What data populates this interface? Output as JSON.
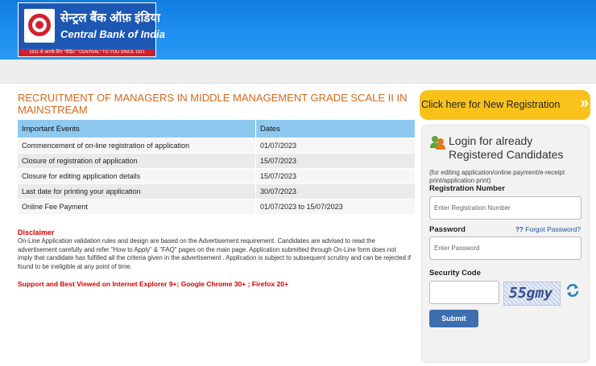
{
  "header": {
    "logo_hindi": "सेन्ट्रल बैंक ऑफ़ इंडिया",
    "logo_english": "Central Bank of India",
    "logo_tagline": "1911 से आपके लिए \"केंद्रित\"   \"CENTRAL\" TO YOU SINCE 1911"
  },
  "page_title": "RECRUITMENT OF MANAGERS IN MIDDLE MANAGEMENT GRADE SCALE II IN MAINSTREAM",
  "events_table": {
    "headers": [
      "Important Events",
      "Dates"
    ],
    "rows": [
      {
        "event": "Commencement of on-line registration of application",
        "date": "01/07/2023"
      },
      {
        "event": "Closure of registration of application",
        "date": "15/07/2023"
      },
      {
        "event": "Closure for editing application details",
        "date": "15/07/2023"
      },
      {
        "event": "Last date for printing your application",
        "date": "30/07/2023"
      },
      {
        "event": "Online Fee Payment",
        "date": "01/07/2023 to 15/07/2023"
      }
    ]
  },
  "disclaimer": {
    "heading": "Disclaimer",
    "text": "On-Line Application validation rules and design are based on the Advertisement requirement. Candidates are advised to read the advertisement carefully and refer \"How to Apply\" & \"FAQ\" pages on the main page. Application submitted through On-Line form does not imply that candidate has fulfilled all the criteria given in the advertisement . Application is subject to subsequent scrutiny and can be rejected if found to be ineligible at any point of time."
  },
  "support_text": "Support and Best Viewed on Internet Explorer 9+; Google Chrome 30+ ; Firefox 20+",
  "new_registration": {
    "label": "Click here for New Registration",
    "chevron": "»"
  },
  "login": {
    "title": "Login for already Registered Candidates",
    "note": "(for editing application/online payment/e-receipt print/application print)",
    "reg_label": "Registration Number",
    "reg_placeholder": "Enter Registration Number",
    "password_label": "Password",
    "password_placeholder": "Enter Password",
    "forgot_mark": "??",
    "forgot_label": "Forgot Password?",
    "security_label": "Security Code",
    "captcha_text": "55gmy",
    "submit_label": "Submit"
  },
  "colors": {
    "header_blue": "#1f8ff0",
    "title_orange": "#d2691e",
    "table_header": "#8fc9ef",
    "registration_yellow": "#f8c21a",
    "submit_blue": "#3d6fae",
    "warning_red": "#d40000"
  }
}
